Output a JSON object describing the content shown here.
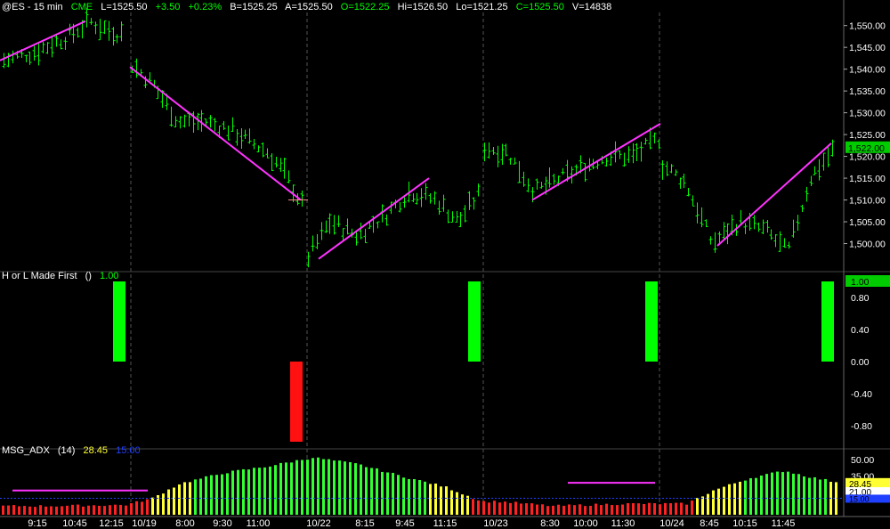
{
  "header": {
    "symbol": "@ES - 15 min",
    "exchange": "CME",
    "last": "L=1525.50",
    "change": "+3.50",
    "change_pct": "+0.23%",
    "bid": "B=1525.25",
    "ask": "A=1525.50",
    "open": "O=1522.25",
    "high": "Hi=1526.50",
    "low": "Lo=1521.25",
    "close": "C=1525.50",
    "volume": "V=14838"
  },
  "indicator1": {
    "name": "H or L Made First",
    "params": "()",
    "value": "1.00",
    "axis_labels": [
      "0.80",
      "0.40",
      "0.00",
      "-0.40",
      "-0.80"
    ],
    "value_badge": "1.00"
  },
  "indicator2": {
    "name": "MSG_ADX",
    "params": "(14)",
    "value1": "28.45",
    "value2": "15.00",
    "axis_labels": [
      "50.00",
      "35.00"
    ],
    "value_badge": "28.45",
    "value_badge2": "21.00",
    "value_badge3": "15.00"
  },
  "price_axis": {
    "labels": [
      "1,550.00",
      "1,545.00",
      "1,540.00",
      "1,535.00",
      "1,530.00",
      "1,525.00",
      "1,520.00",
      "1,515.00",
      "1,510.00",
      "1,505.00",
      "1,500.00"
    ],
    "last_badge": "1,522.00"
  },
  "time_axis": {
    "labels": [
      "9:15",
      "10:45",
      "12:15",
      "10/19",
      "8:00",
      "9:30",
      "11:00",
      "10/22",
      "8:15",
      "9:45",
      "11:15",
      "10/23",
      "8:30",
      "10:00",
      "11:30",
      "10/24",
      "8:45",
      "10:15",
      "11:45"
    ]
  },
  "colors": {
    "background": "#000000",
    "bars": "#00ff00",
    "trendline": "#ff33ff",
    "up_signal": "#00ff00",
    "down_signal": "#ff1111",
    "adx_strong": "#33ff33",
    "adx_mid": "#ffff33",
    "adx_low": "#ff2222"
  },
  "chart_data": [
    {
      "type": "bar",
      "title": "@ES - 15 min",
      "ylim": [
        1495,
        1553
      ],
      "segment_count": 4,
      "trendline_endpoints_price": [
        [
          1542,
          1551
        ],
        [
          1540.5,
          1510
        ],
        [
          1496.5,
          1515
        ],
        [
          1510,
          1527.5
        ],
        [
          1499.5,
          1523
        ]
      ]
    },
    {
      "type": "bar",
      "title": "H or L Made First",
      "ylim": [
        -1,
        1
      ],
      "values": [
        1,
        -1,
        1,
        1,
        1
      ]
    },
    {
      "type": "bar",
      "title": "MSG_ADX",
      "params": "(14)",
      "ylim": [
        0,
        55
      ],
      "last": 28.45,
      "threshold": 15
    }
  ]
}
